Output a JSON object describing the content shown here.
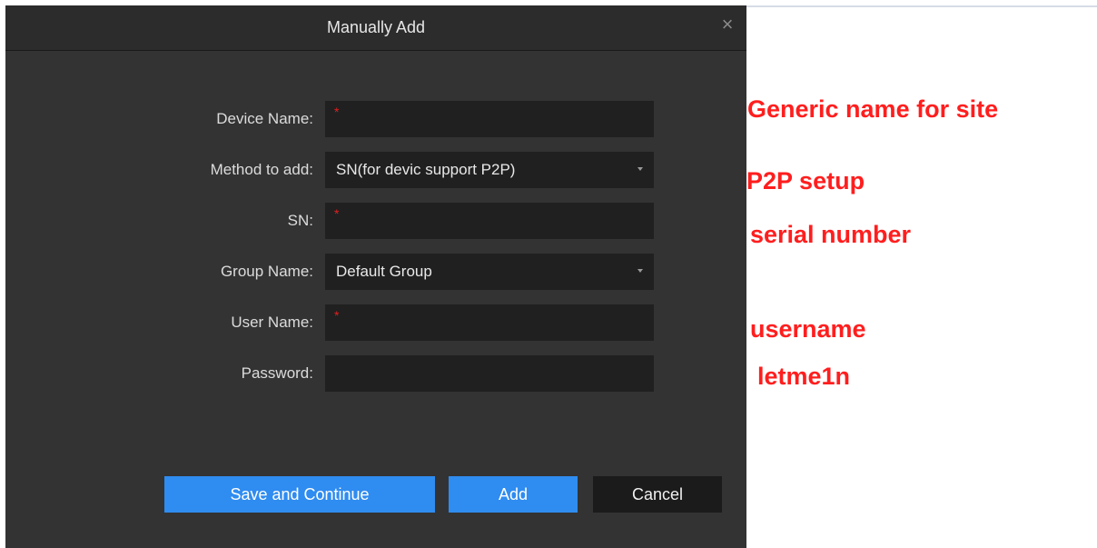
{
  "dialog": {
    "title": "Manually Add",
    "close_icon": "close-icon",
    "fields": [
      {
        "label": "Device Name:",
        "value": "",
        "required_mark": "*"
      },
      {
        "label": "Method to add:",
        "value": "SN(for devic support P2P)"
      },
      {
        "label": "SN:",
        "value": "",
        "required_mark": "*"
      },
      {
        "label": "Group Name:",
        "value": "Default Group"
      },
      {
        "label": "User Name:",
        "value": "",
        "required_mark": "*"
      },
      {
        "label": "Password:",
        "value": ""
      }
    ],
    "buttons": {
      "save_continue": "Save and Continue",
      "add": "Add",
      "cancel": "Cancel"
    }
  },
  "annotations": [
    "Generic name for site",
    "P2P setup",
    "serial number",
    "username",
    "letme1n"
  ],
  "colors": {
    "dialog_bg": "#333333",
    "field_bg": "#202020",
    "primary": "#2f8cf0",
    "annotation": "#ff1e1e",
    "required": "#e02020"
  }
}
